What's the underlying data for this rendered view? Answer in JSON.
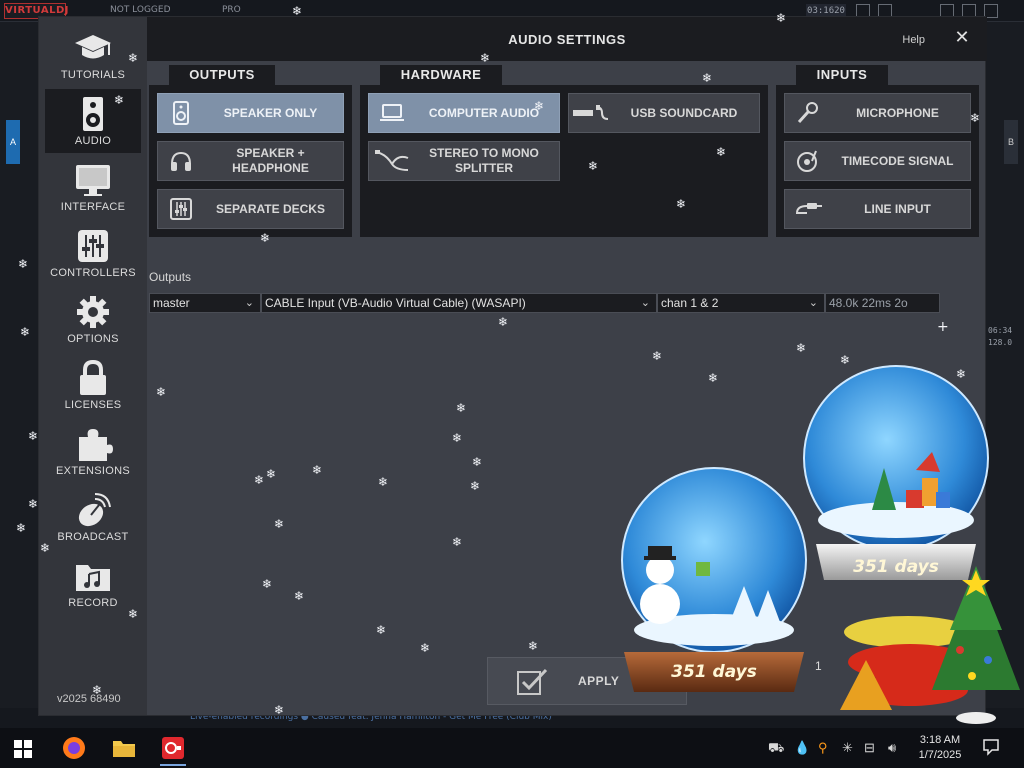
{
  "background_app": {
    "top_status": "NOT LOGGED",
    "top_mode": "PRO",
    "clock": "03:1620",
    "side_a": "A",
    "side_b": "B",
    "right_numbers": [
      "06:34",
      "128.0"
    ],
    "ticker": "Live-enabled recordings ● Caused feat. Jenna Hamilton - Get Me Free (Club Mix)"
  },
  "dialog": {
    "title": "AUDIO SETTINGS",
    "help_label": "Help",
    "close_symbol": "✕"
  },
  "sidebar": {
    "items": [
      {
        "label": "TUTORIALS",
        "icon": "graduation-cap-icon"
      },
      {
        "label": "AUDIO",
        "icon": "speaker-icon",
        "active": true
      },
      {
        "label": "INTERFACE",
        "icon": "monitor-icon"
      },
      {
        "label": "CONTROLLERS",
        "icon": "sliders-icon"
      },
      {
        "label": "OPTIONS",
        "icon": "gear-icon"
      },
      {
        "label": "LICENSES",
        "icon": "lock-icon"
      },
      {
        "label": "EXTENSIONS",
        "icon": "puzzle-icon"
      },
      {
        "label": "BROADCAST",
        "icon": "satellite-dish-icon"
      },
      {
        "label": "RECORD",
        "icon": "music-folder-icon"
      }
    ],
    "version": "v2025 68490"
  },
  "outputs_panel": {
    "tab": "OUTPUTS",
    "buttons": [
      {
        "label": "SPEAKER ONLY",
        "icon": "speaker-icon",
        "selected": true
      },
      {
        "label_line1": "SPEAKER +",
        "label_line2": "HEADPHONE",
        "icon": "headphone-icon",
        "selected": false
      },
      {
        "label": "SEPARATE DECKS",
        "icon": "mixer-icon",
        "selected": false
      }
    ]
  },
  "hardware_panel": {
    "tab": "HARDWARE",
    "buttons": [
      {
        "label": "COMPUTER AUDIO",
        "icon": "laptop-icon",
        "selected": true
      },
      {
        "label": "USB SOUNDCARD",
        "icon": "usb-icon",
        "selected": false
      },
      {
        "label_line1": "STEREO TO MONO",
        "label_line2": "SPLITTER",
        "icon": "splitter-cable-icon",
        "selected": false
      }
    ]
  },
  "inputs_panel": {
    "tab": "INPUTS",
    "buttons": [
      {
        "label": "MICROPHONE",
        "icon": "microphone-icon",
        "selected": false
      },
      {
        "label": "TIMECODE SIGNAL",
        "icon": "turntable-icon",
        "selected": false
      },
      {
        "label": "LINE INPUT",
        "icon": "line-cable-icon",
        "selected": false
      }
    ]
  },
  "outputs_config": {
    "label": "Outputs",
    "channel": "master",
    "device": "CABLE Input (VB-Audio Virtual Cable) (WASAPI)",
    "channels": "chan 1 & 2",
    "readout": "48.0k 22ms 2o"
  },
  "footer": {
    "apply_label": "APPLY",
    "apply_suffix": "1"
  },
  "decorations": {
    "globe1_text": "351 days",
    "globe2_text": "351 days"
  },
  "taskbar": {
    "time": "3:18 AM",
    "date": "1/7/2025",
    "apps": [
      "windows-start-icon",
      "firefox-icon",
      "file-explorer-icon",
      "virtualdj-icon"
    ]
  },
  "colors": {
    "dialog_bg": "#3d4048",
    "panel_bg": "#1b1c20",
    "selected_button": "#7f91a8",
    "button_bg": "#3f4148"
  }
}
